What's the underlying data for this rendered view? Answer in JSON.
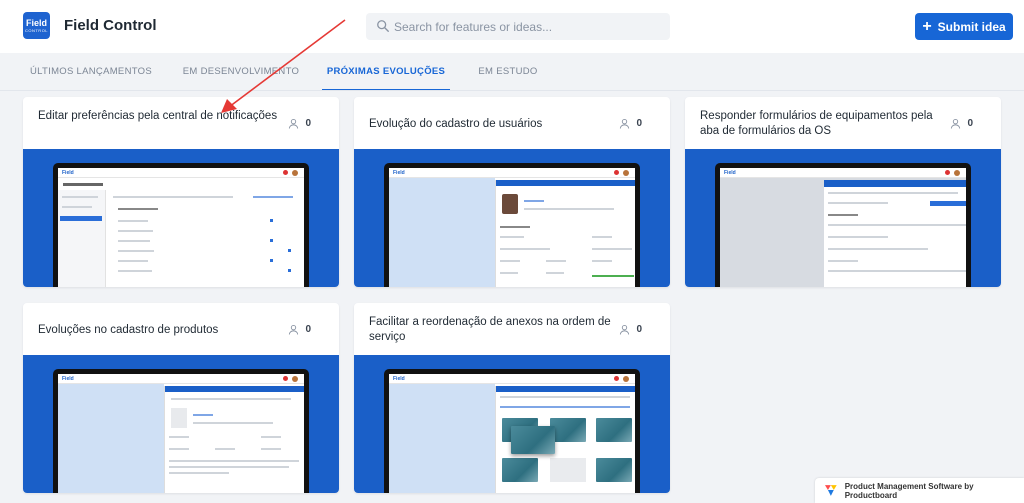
{
  "header": {
    "logo_line1": "Field",
    "logo_line2": "CONTROL",
    "title": "Field Control",
    "search_placeholder": "Search for features or ideas...",
    "submit_label": "Submit idea"
  },
  "tabs": [
    {
      "label": "ÚLTIMOS LANÇAMENTOS",
      "active": false
    },
    {
      "label": "EM DESENVOLVIMENTO",
      "active": false
    },
    {
      "label": "PRÓXIMAS EVOLUÇÕES",
      "active": true
    },
    {
      "label": "EM ESTUDO",
      "active": false
    }
  ],
  "cards": [
    {
      "title": "Editar preferências pela central de notificações",
      "votes": "0"
    },
    {
      "title": "Evolução do cadastro de usuários",
      "votes": "0"
    },
    {
      "title": "Responder formulários de equipamentos pela aba de formulários da OS",
      "votes": "0"
    },
    {
      "title": "Evoluções no cadastro de produtos",
      "votes": "0"
    },
    {
      "title": "Facilitar a reordenação de anexos na ordem de serviço",
      "votes": "0"
    }
  ],
  "footer": {
    "badge_text": "Product Management Software by Productboard"
  },
  "colors": {
    "brand_blue": "#1766d6",
    "banner_blue": "#1a5fc8",
    "annotation_red": "#e53935"
  }
}
